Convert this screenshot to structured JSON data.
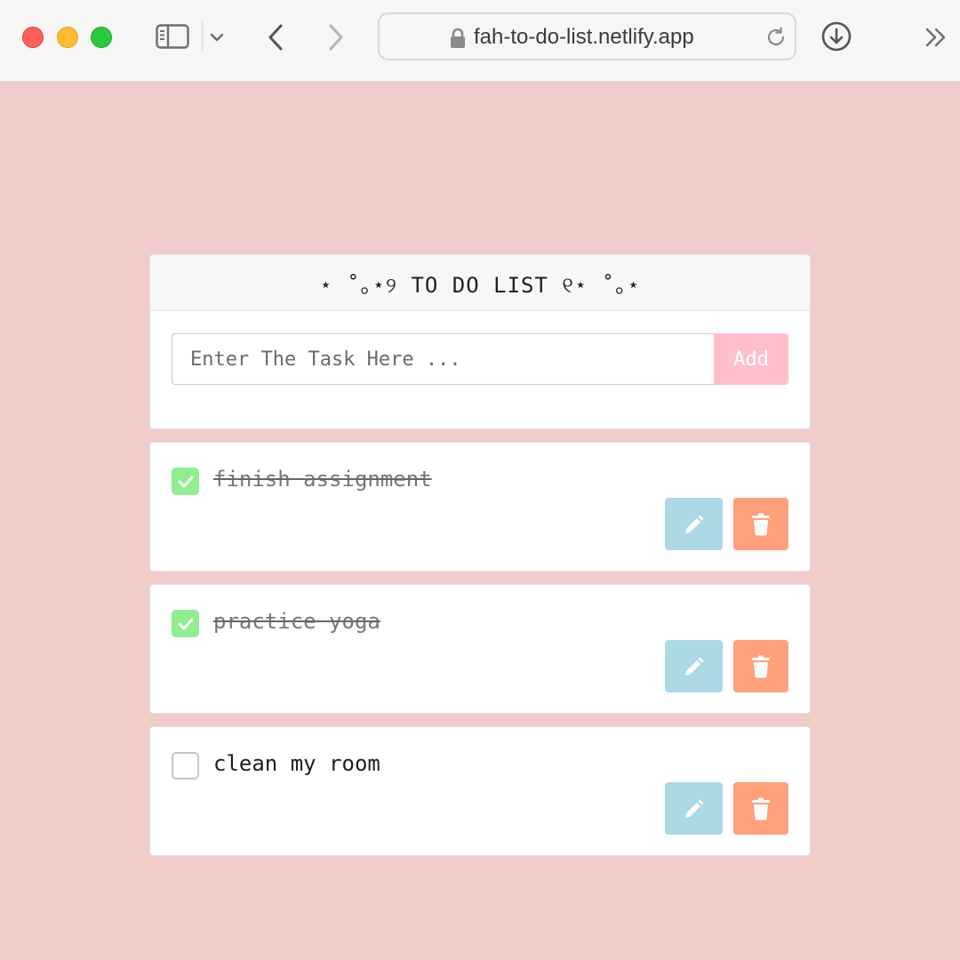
{
  "browser": {
    "url": "fah-to-do-list.netlify.app"
  },
  "app": {
    "title": "⋆ ˚｡⋆୨ TO DO LIST ୧⋆ ˚｡⋆",
    "input": {
      "placeholder": "Enter The Task Here ...",
      "value": ""
    },
    "add_label": "Add",
    "colors": {
      "background": "#f2cbcb",
      "add_button": "#ffc0cb",
      "checked": "#90ee90",
      "edit_button": "#add8e6",
      "delete_button": "#ffa07a"
    }
  },
  "tasks": [
    {
      "text": "finish assignment",
      "completed": true,
      "edit_icon": "pencil-icon",
      "delete_icon": "trash-icon"
    },
    {
      "text": "practice yoga",
      "completed": true,
      "edit_icon": "pencil-icon",
      "delete_icon": "trash-icon"
    },
    {
      "text": "clean my room",
      "completed": false,
      "edit_icon": "pencil-icon",
      "delete_icon": "trash-icon"
    }
  ]
}
